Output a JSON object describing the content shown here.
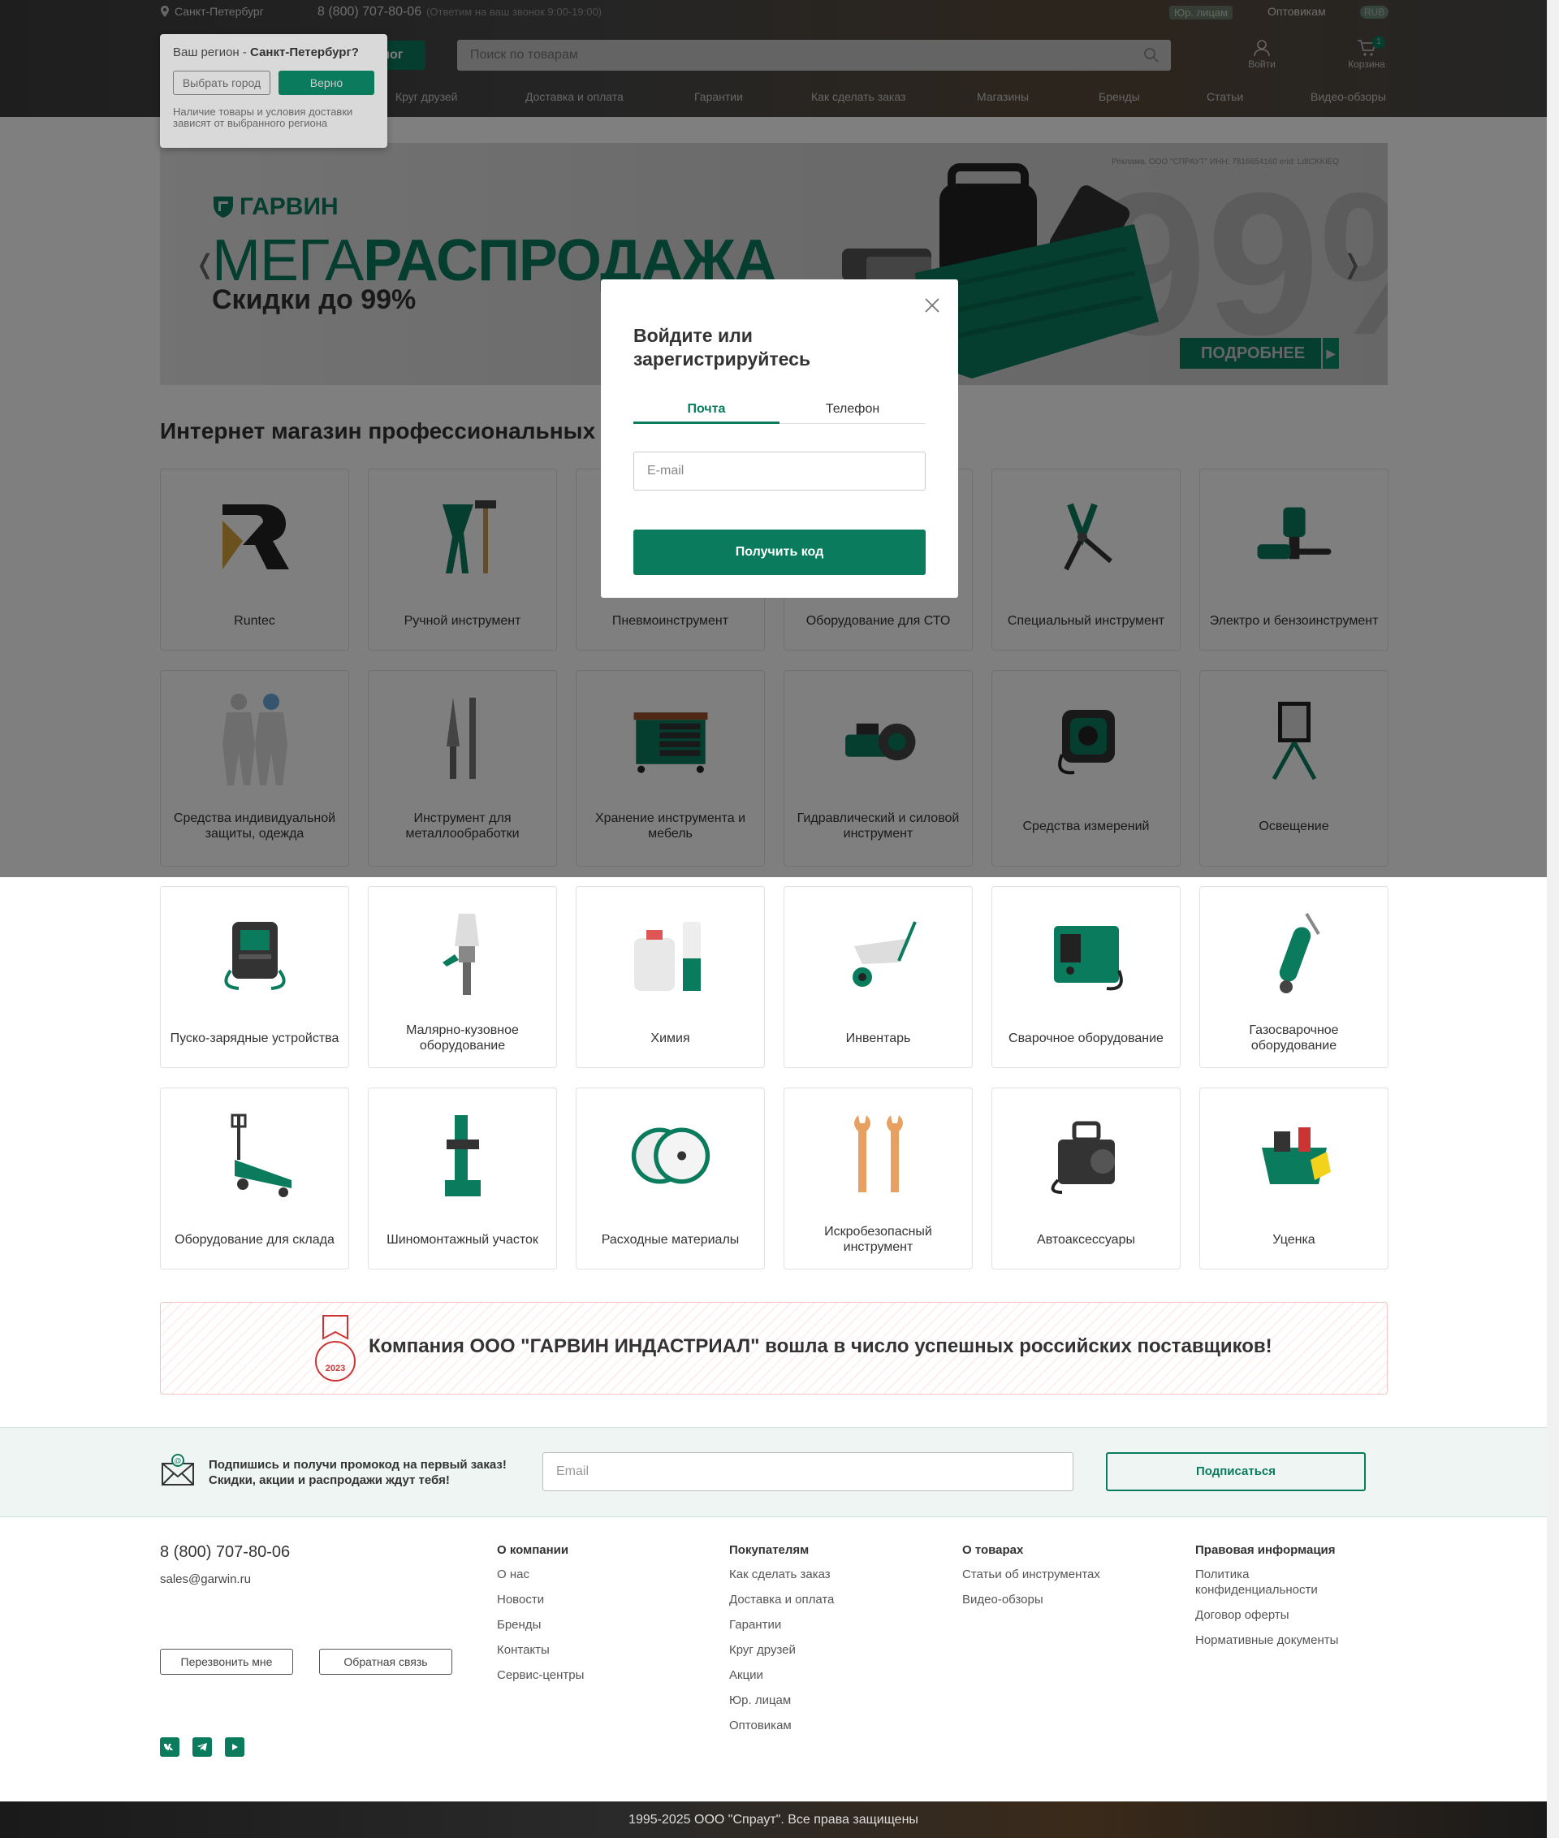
{
  "topbar": {
    "city": "Санкт-Петербург",
    "phone": "8 (800) 707-80-06",
    "hours": "(Ответим на ваш звонок 9:00-19:00)",
    "legal": "Юр. лицам",
    "wholesale": "Оптовикам",
    "currency": "RUB"
  },
  "header": {
    "catalog_label": "лог",
    "search_placeholder": "Поиск по товарам",
    "login_label": "Войти",
    "cart_label": "Корзина",
    "cart_count": "1"
  },
  "nav": [
    "Круг друзей",
    "Доставка и оплата",
    "Гарантии",
    "Как сделать заказ",
    "Магазины",
    "Бренды",
    "Статьи",
    "Видео-обзоры"
  ],
  "region_popup": {
    "prefix": "Ваш регион - ",
    "city": "Санкт-Петербург?",
    "choose_label": "Выбрать город",
    "confirm_label": "Верно",
    "note": "Наличие товары и условия доставки зависят от выбранного региона"
  },
  "banner": {
    "ad_text": "Реклама. ООО \"СПРАУТ\" ИНН: 7816654160 erid: LdtCKKiEQ",
    "brand": "ГАРВИН",
    "mega_light": "МЕГА",
    "mega_bold": "РАСПРОДАЖА",
    "sale": "Скидки до 99%",
    "big": "99%",
    "more_label": "ПОДРОБНЕЕ",
    "prev": "❬",
    "next": "❭"
  },
  "section_title": "Интернет магазин профессиональных ин",
  "categories": [
    "Runtec",
    "Ручной инструмент",
    "Пневмоинструмент",
    "Оборудование для СТО",
    "Специальный инструмент",
    "Электро и бензоинструмент",
    "Средства индивидуальной защиты, одежда",
    "Инструмент для металлообработки",
    "Хранение инструмента и мебель",
    "Гидравлический и силовой инструмент",
    "Средства измерений",
    "Освещение",
    "Пуско-зарядные устройства",
    "Малярно-кузовное оборудование",
    "Химия",
    "Инвентарь",
    "Сварочное оборудование",
    "Газосварочное оборудование",
    "Оборудование для склада",
    "Шиномонтажный участок",
    "Расходные материалы",
    "Искробезопасный инструмент",
    "Автоаксессуары",
    "Уценка"
  ],
  "modal": {
    "title": "Войдите или зарегистрируйтесь",
    "tab_email": "Почта",
    "tab_phone": "Телефон",
    "email_placeholder": "E-mail",
    "submit_label": "Получить код"
  },
  "promo": {
    "text": "Компания ООО \"ГАРВИН ИНДАСТРИАЛ\" вошла в число успешных российских поставщиков!",
    "badge_year": "2023"
  },
  "subscribe": {
    "line1": "Подпишись и получи промокод на первый заказ!",
    "line2": "Скидки, акции и распродажи ждут тебя!",
    "placeholder": "Email",
    "button": "Подписаться"
  },
  "footer": {
    "phone": "8 (800) 707-80-06",
    "email": "sales@garwin.ru",
    "callback_label": "Перезвонить мне",
    "feedback_label": "Обратная связь",
    "columns": [
      {
        "title": "О компании",
        "items": [
          "О нас",
          "Новости",
          "Бренды",
          "Контакты",
          "Сервис-центры"
        ]
      },
      {
        "title": "Покупателям",
        "items": [
          "Как сделать заказ",
          "Доставка и оплата",
          "Гарантии",
          "Круг друзей",
          "Акции",
          "Юр. лицам",
          "Оптовикам"
        ]
      },
      {
        "title": "О товарах",
        "items": [
          "Статьи об инструментах",
          "Видео-обзоры"
        ]
      },
      {
        "title": "Правовая информация",
        "items": [
          "Политика конфиденциальности",
          "Договор оферты",
          "Нормативные документы"
        ]
      }
    ],
    "copyright": "1995-2025 ООО \"Спраут\". Все права защищены"
  },
  "colors": {
    "brand": "#0a7b5c",
    "text": "#333333"
  }
}
